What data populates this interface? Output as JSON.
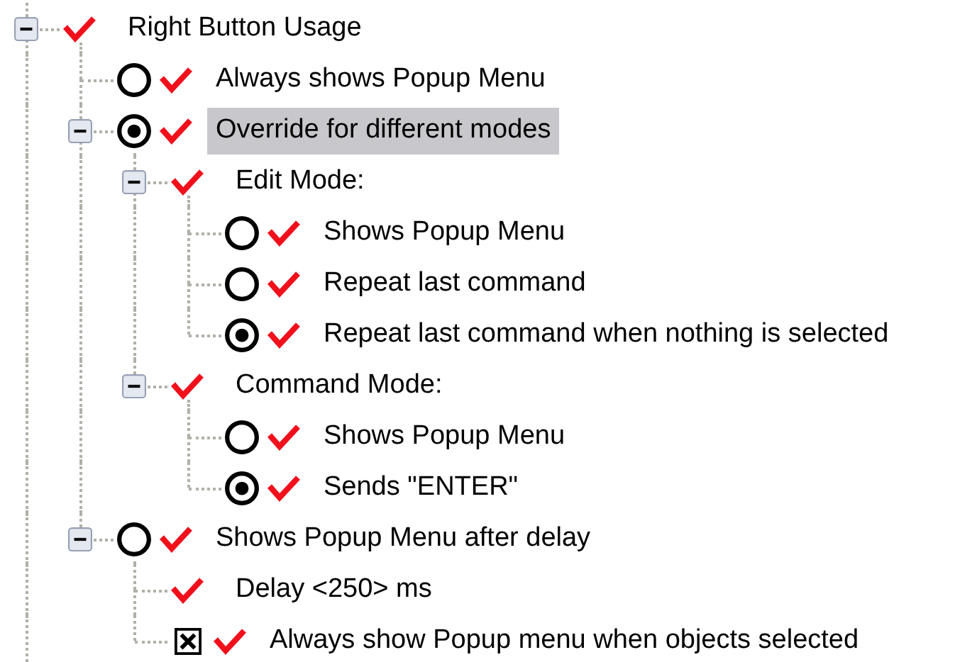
{
  "tree": [
    {
      "label": "Right Button Usage",
      "kind": "group",
      "expanded": true,
      "selected": false,
      "children": [
        {
          "label": "Always shows Popup Menu",
          "kind": "radio",
          "checked": false,
          "selected": false
        },
        {
          "label": "Override for different modes",
          "kind": "radio",
          "checked": true,
          "selected": true,
          "expanded": true,
          "children": [
            {
              "label": "Edit Mode:",
              "kind": "group",
              "selected": false,
              "expanded": true,
              "children": [
                {
                  "label": "Shows Popup Menu",
                  "kind": "radio",
                  "checked": false,
                  "selected": false
                },
                {
                  "label": "Repeat last command",
                  "kind": "radio",
                  "checked": false,
                  "selected": false
                },
                {
                  "label": "Repeat last command when nothing is selected",
                  "kind": "radio",
                  "checked": true,
                  "selected": false
                }
              ]
            },
            {
              "label": "Command Mode:",
              "kind": "group",
              "selected": false,
              "expanded": true,
              "children": [
                {
                  "label": "Shows Popup Menu",
                  "kind": "radio",
                  "checked": false,
                  "selected": false
                },
                {
                  "label": "Sends \"ENTER\"",
                  "kind": "radio",
                  "checked": true,
                  "selected": false
                }
              ]
            }
          ]
        },
        {
          "label": "Shows Popup Menu after delay",
          "kind": "radio",
          "checked": false,
          "selected": false,
          "expanded": true,
          "children": [
            {
              "label": "Delay <250> ms",
              "kind": "group",
              "selected": false
            },
            {
              "label": "Always show Popup menu when objects selected",
              "kind": "checkbox",
              "checked": true,
              "selected": false
            }
          ]
        }
      ]
    }
  ]
}
